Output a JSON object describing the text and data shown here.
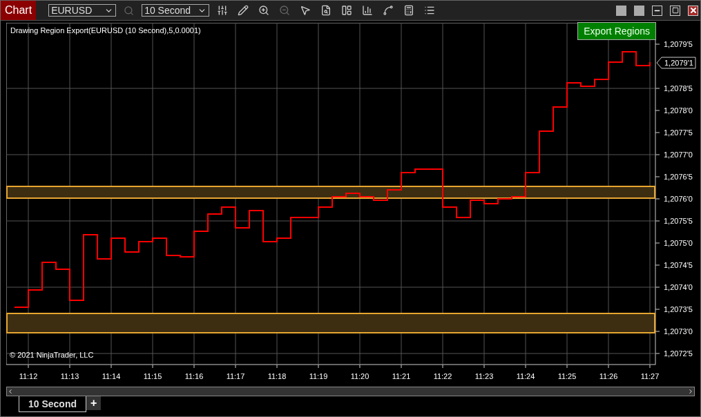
{
  "toolbar": {
    "title": "Chart",
    "instrument": "EURUSD",
    "interval": "10 Second"
  },
  "chart": {
    "indicator_label": "Drawing Region Export(EURUSD (10 Second),5,0.0001)",
    "export_button": "Export Regions",
    "copyright": "© 2021 NinjaTrader, LLC",
    "price_labels": [
      "1,2079'5",
      "1,2078'5",
      "1,2078'0",
      "1,2077'5",
      "1,2077'0",
      "1,2076'5",
      "1,2076'0",
      "1,2075'5",
      "1,2075'0",
      "1,2074'5",
      "1,2074'0",
      "1,2073'5",
      "1,2073'0",
      "1,2072'5"
    ],
    "current_price": "1,2079'1",
    "time_labels": [
      "11:12",
      "11:13",
      "11:14",
      "11:15",
      "11:16",
      "11:17",
      "11:18",
      "11:19",
      "11:20",
      "11:21",
      "11:22",
      "11:23",
      "11:24",
      "11:25",
      "11:26",
      "11:27"
    ]
  },
  "tabs": [
    {
      "label": "10 Second",
      "selected": true
    }
  ],
  "add_tab": "+"
}
